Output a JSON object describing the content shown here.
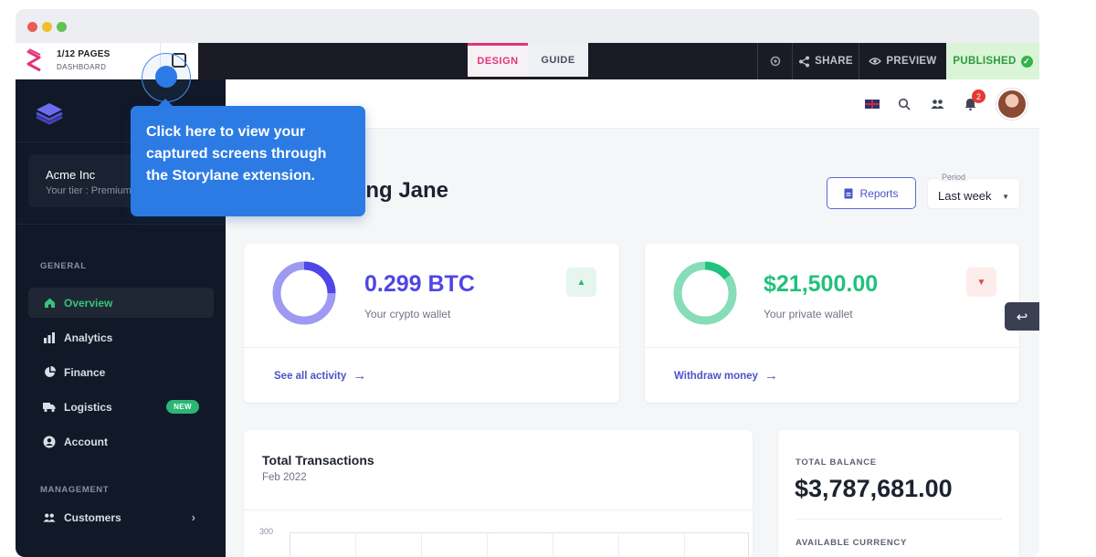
{
  "editor": {
    "pages_count": "1/12 PAGES",
    "page_name": "DASHBOARD",
    "tabs": [
      {
        "label": "DESIGN",
        "active": true
      },
      {
        "label": "GUIDE",
        "active": false
      }
    ],
    "share_label": "SHARE",
    "preview_label": "PREVIEW",
    "published_label": "PUBLISHED"
  },
  "sidebar": {
    "org_name": "Acme Inc",
    "org_tier": "Your tier : Premium",
    "general_label": "GENERAL",
    "management_label": "MANAGEMENT",
    "items": [
      {
        "label": "Overview",
        "icon": "home-icon",
        "active": true
      },
      {
        "label": "Analytics",
        "icon": "bar-chart-icon"
      },
      {
        "label": "Finance",
        "icon": "pie-chart-icon"
      },
      {
        "label": "Logistics",
        "icon": "truck-icon",
        "badge": "NEW"
      },
      {
        "label": "Account",
        "icon": "user-circle-icon"
      }
    ],
    "management_items": [
      {
        "label": "Customers",
        "icon": "users-icon"
      }
    ]
  },
  "header": {
    "notification_count": "2"
  },
  "main": {
    "greeting": "hing Jane",
    "reports_label": "Reports",
    "period_label": "Period",
    "period_value": "Last week"
  },
  "wallets": [
    {
      "amount": "0.299 BTC",
      "label": "Your crypto wallet",
      "link": "See all activity",
      "color": "#4f46e5",
      "ring_fill": 0.75,
      "trend": "up"
    },
    {
      "amount": "$21,500.00",
      "label": "Your private wallet",
      "link": "Withdraw money",
      "color": "#22c17d",
      "ring_fill": 0.85,
      "trend": "down"
    }
  ],
  "transactions": {
    "title": "Total Transactions",
    "subtitle": "Feb 2022",
    "y_tick": "300"
  },
  "balance": {
    "label": "TOTAL BALANCE",
    "amount": "$3,787,681.00",
    "currency_label": "AVAILABLE CURRENCY"
  },
  "tooltip": {
    "text": "Click here to view your captured screens through the Storylane extension."
  },
  "colors": {
    "accent": "#2c7be5",
    "design_tab": "#e2337a",
    "sidebar_bg": "#111827",
    "active_green": "#35c47d"
  }
}
